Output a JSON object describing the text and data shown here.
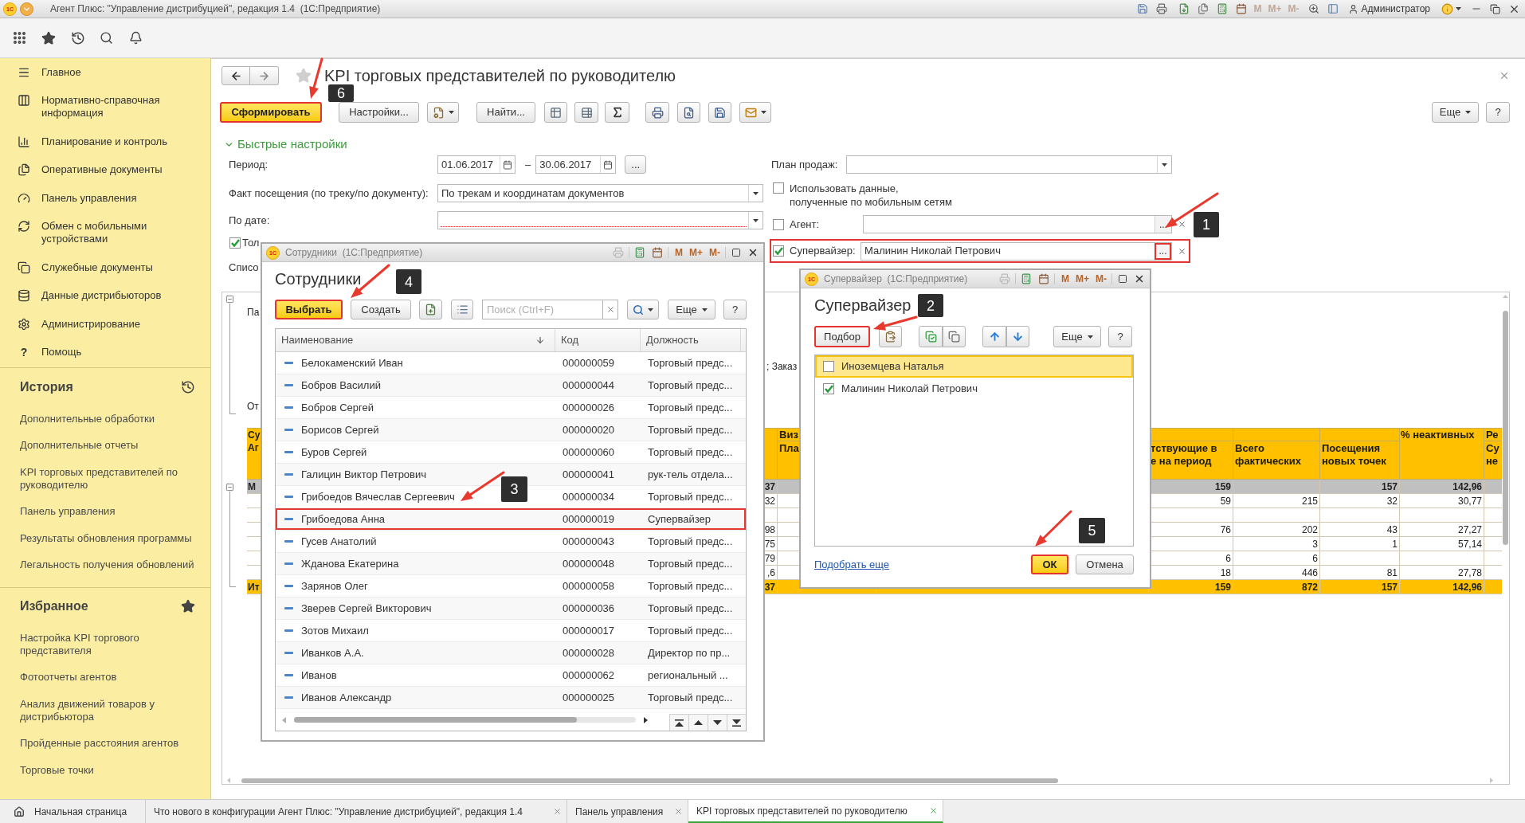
{
  "app_window": {
    "logo_text": "1С",
    "title": "Агент Плюс: \"Управление дистрибуцией\", редакция 1.4  (1С:Предприятие)",
    "memory_buttons": [
      "M",
      "M+",
      "M-"
    ],
    "user": "Администратор"
  },
  "sections_panel": [
    {
      "label": "Главное"
    },
    {
      "label": "Нормативно-справочная информация"
    },
    {
      "label": "Планирование и контроль"
    },
    {
      "label": "Оперативные документы"
    },
    {
      "label": "Панель управления"
    },
    {
      "label": "Обмен с мобильными устройствами"
    },
    {
      "label": "Служебные документы"
    },
    {
      "label": "Данные дистрибьюторов"
    },
    {
      "label": "Администрирование"
    },
    {
      "label": "Помощь",
      "glyph": "?"
    }
  ],
  "history": {
    "title": "История",
    "items": [
      "Дополнительные обработки",
      "Дополнительные отчеты",
      "KPI торговых представителей по руководителю",
      "Панель управления",
      "Результаты обновления программы",
      "Легальность получения обновлений"
    ]
  },
  "favorites": {
    "title": "Избранное",
    "items": [
      "Настройка KPI торгового представителя",
      "Фотоотчеты агентов",
      "Анализ движений товаров у дистрибьютора",
      "Пройденные расстояния агентов",
      "Торговые точки"
    ]
  },
  "form": {
    "title": "KPI торговых представителей по руководителю",
    "favorite": false,
    "toolbar": {
      "generate_button": {
        "label": "Сформировать",
        "highlighted": true
      },
      "settings_button": "Настройки...",
      "find_button": "Найти...",
      "more_button": "Еще",
      "help_button": "?"
    },
    "quick_settings": {
      "title": "Быстрые настройки",
      "expanded": true
    },
    "period": {
      "label": "Период:",
      "from": "01.06.2017",
      "separator": "–",
      "to": "30.06.2017",
      "more_button": "..."
    },
    "visit_fact": {
      "label": "Факт посещения (по треку/по документу):",
      "value": "По трекам и координатам документов"
    },
    "by_date": {
      "label": "По дате:",
      "required": true
    },
    "only_checkbox": {
      "label": "Тол",
      "checked": true
    },
    "list_label": "Списо",
    "sales_plan": {
      "label": "План продаж:"
    },
    "use_mobile_data": {
      "lines": [
        "Использовать данные,",
        "полученные по мобильным сетям"
      ],
      "checked": false
    },
    "agent": {
      "label": "Агент:",
      "checked": false,
      "more_button": {
        "label": "...",
        "highlighted": false
      }
    },
    "supervisor": {
      "label": "Супервайзер:",
      "checked": true,
      "value": "Малинин Николай Петрович",
      "more_button": {
        "label": "...",
        "highlighted": true
      },
      "highlighted": true
    }
  },
  "report": {
    "parameters_label": "Па",
    "filter_text": "; Заказ",
    "selection_label": "От",
    "header": {
      "column_1": {
        "lines": [
          "Су",
          "Аг"
        ]
      },
      "column_3": {
        "lines": [
          "Виз"
        ],
        "sub_lines": [
          "Пла"
        ]
      },
      "column_4": {
        "sub_lines": [
          "тствующие в",
          "е на период"
        ]
      },
      "column_5": {
        "sub_lines": [
          "Всего",
          "фактических"
        ]
      },
      "column_6": {
        "sub_lines": [
          "Посещения",
          "новых точек"
        ]
      },
      "column_7": {
        "lines": [
          "% неактивных"
        ]
      },
      "column_8": {
        "lines": [
          "Ре"
        ],
        "sub_lines": [
          "Су",
          "не"
        ]
      }
    },
    "rows": [
      {
        "kind": "group",
        "cells": {
          "column_1": "М",
          "column_2": "37",
          "column_4": "159",
          "column_6": "157",
          "column_7": "142,96"
        }
      },
      {
        "kind": "item",
        "cells": {
          "column_2": "32",
          "column_4": "59",
          "column_5": "215",
          "column_6": "32",
          "column_7": "30,77"
        }
      },
      {
        "kind": "item"
      },
      {
        "kind": "item",
        "cells": {
          "column_2": "98",
          "column_4": "76",
          "column_5": "202",
          "column_6": "43",
          "column_7": "27,27"
        }
      },
      {
        "kind": "item",
        "cells": {
          "column_2": "75",
          "column_5": "3",
          "column_6": "1",
          "column_7": "57,14"
        }
      },
      {
        "kind": "item",
        "cells": {
          "column_2": "79",
          "column_4": "6",
          "column_5": "6"
        }
      },
      {
        "kind": "item",
        "cells": {
          "column_2": ",6",
          "column_4": "18",
          "column_5": "446",
          "column_6": "81",
          "column_7": "27,78"
        }
      },
      {
        "kind": "total",
        "cells": {
          "column_1": "Ит",
          "column_2": "37",
          "column_4": "159",
          "column_5": "872",
          "column_6": "157",
          "column_7": "142,96"
        }
      }
    ]
  },
  "employees_dialog": {
    "logo_text": "1С",
    "window_title": "Сотрудники  (1С:Предприятие)",
    "memory_buttons": [
      "M",
      "M+",
      "M-"
    ],
    "heading": "Сотрудники",
    "select_button": {
      "label": "Выбрать",
      "highlighted": true
    },
    "create_button": "Создать",
    "search": {
      "placeholder": "Поиск (Ctrl+F)"
    },
    "more_button": "Еще",
    "help_button": "?",
    "columns": [
      {
        "label": "Наименование",
        "sorted": true
      },
      {
        "label": "Код",
        "sorted": false
      },
      {
        "label": "Должность",
        "sorted": false
      }
    ],
    "rows": [
      {
        "name": "Белокаменский Иван",
        "code": "000000059",
        "position": "Торговый предс...",
        "highlighted": false
      },
      {
        "name": "Бобров Василий",
        "code": "000000044",
        "position": "Торговый предс...",
        "highlighted": false
      },
      {
        "name": "Бобров Сергей",
        "code": "000000026",
        "position": "Торговый предс...",
        "highlighted": false
      },
      {
        "name": "Борисов Сергей",
        "code": "000000020",
        "position": "Торговый предс...",
        "highlighted": false
      },
      {
        "name": "Буров Сергей",
        "code": "000000060",
        "position": "Торговый предс...",
        "highlighted": false
      },
      {
        "name": "Галицин Виктор Петрович",
        "code": "000000041",
        "position": "рук-тель отдела...",
        "highlighted": false
      },
      {
        "name": "Грибоедов Вячеслав Сергеевич",
        "code": "000000034",
        "position": "Торговый предс...",
        "highlighted": false
      },
      {
        "name": "Грибоедова Анна",
        "code": "000000019",
        "position": "Супервайзер",
        "highlighted": true
      },
      {
        "name": "Гусев Анатолий",
        "code": "000000043",
        "position": "Торговый предс...",
        "highlighted": false
      },
      {
        "name": "Жданова Екатерина",
        "code": "000000048",
        "position": "Торговый предс...",
        "highlighted": false
      },
      {
        "name": "Зарянов Олег",
        "code": "000000058",
        "position": "Торговый предс...",
        "highlighted": false
      },
      {
        "name": "Зверев Сергей Викторович",
        "code": "000000036",
        "position": "Торговый предс...",
        "highlighted": false
      },
      {
        "name": "Зотов Михаил",
        "code": "000000017",
        "position": "Торговый предс...",
        "highlighted": false
      },
      {
        "name": "Иванков А.А.",
        "code": "000000028",
        "position": "Директор по пр...",
        "highlighted": false
      },
      {
        "name": "Иванов",
        "code": "000000062",
        "position": "региональный ...",
        "highlighted": false
      },
      {
        "name": "Иванов Александр",
        "code": "000000025",
        "position": "Торговый предс...",
        "highlighted": false
      }
    ]
  },
  "supervisor_dialog": {
    "logo_text": "1С",
    "window_title": "Супервайзер  (1С:Предприятие)",
    "memory_buttons": [
      "M",
      "M+",
      "M-"
    ],
    "heading": "Супервайзер",
    "pick_button": {
      "label": "Подбор",
      "highlighted": true
    },
    "more_button": "Еще",
    "help_button": "?",
    "items": [
      {
        "label": "Иноземцева Наталья",
        "checked": false,
        "selected": true
      },
      {
        "label": "Малинин Николай Петрович",
        "checked": true,
        "selected": false
      }
    ],
    "pick_more_link": "Подобрать еще",
    "ok_button": {
      "label": "ОК",
      "highlighted": true
    },
    "cancel_button": "Отмена"
  },
  "annotations": [
    "1",
    "2",
    "3",
    "4",
    "5",
    "6"
  ],
  "open_tabs": [
    {
      "kind": "home",
      "label": "Начальная страница",
      "selected": false
    },
    {
      "kind": "page",
      "label": "Что нового в конфигурации Агент Плюс: \"Управление дистрибуцией\", редакция 1.4",
      "selected": false
    },
    {
      "kind": "page",
      "label": "Панель управления",
      "selected": false
    },
    {
      "kind": "page",
      "label": "KPI торговых представителей по руководителю",
      "selected": true
    }
  ]
}
